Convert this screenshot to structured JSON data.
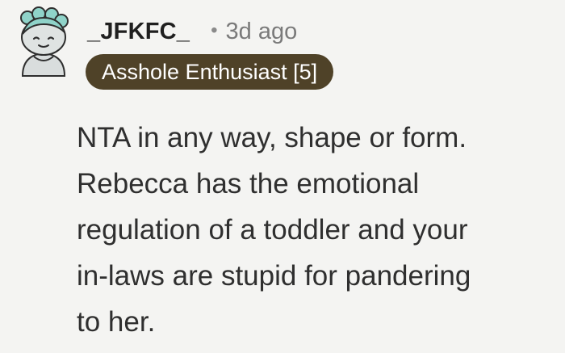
{
  "comment": {
    "avatar_icon": "snoo-avatar-icon",
    "username": "_JFKFC_",
    "separator": "•",
    "time": "3d ago",
    "flair": "Asshole Enthusiast [5]",
    "flair_color": "#4f4228",
    "body_lines": [
      "NTA in any way, shape or form.",
      "Rebecca has the emotional",
      "regulation of a toddler and your",
      "in-laws are stupid for pandering",
      "to her."
    ]
  }
}
